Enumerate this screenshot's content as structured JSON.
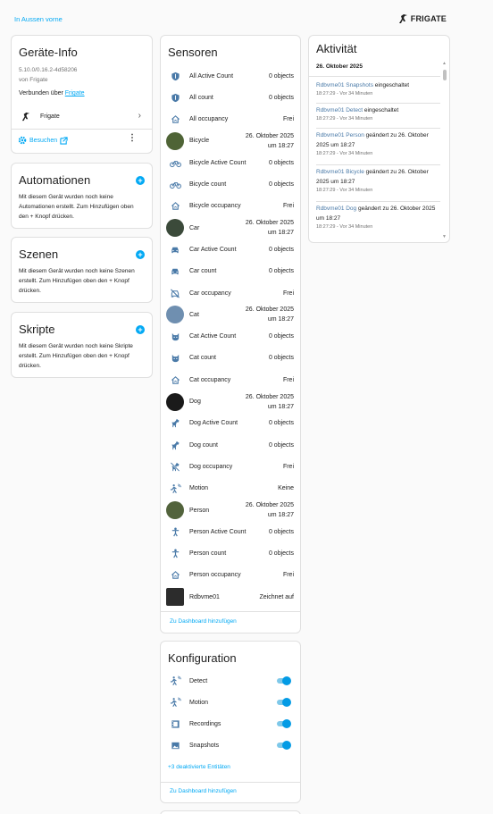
{
  "header": {
    "area": "In Aussen vorne",
    "brand": "FRIGATE"
  },
  "device_info": {
    "title": "Geräte-Info",
    "version": "5.10.0/0.16.2-4d58206",
    "vendor": "von Frigate",
    "connected_prefix": "Verbunden über ",
    "connected_link": "Frigate",
    "integration": "Frigate",
    "search_label": "Besuchen"
  },
  "automations": {
    "title": "Automationen",
    "text": "Mit diesem Gerät wurden noch keine Automationen erstellt. Zum Hinzufügen oben den + Knopf drücken."
  },
  "scenes": {
    "title": "Szenen",
    "text": "Mit diesem Gerät wurden noch keine Szenen erstellt. Zum Hinzufügen oben den + Knopf drücken."
  },
  "scripts": {
    "title": "Skripte",
    "text": "Mit diesem Gerät wurden noch keine Skripte erstellt. Zum Hinzufügen oben den + Knopf drücken."
  },
  "sensors": {
    "title": "Sensoren",
    "rows": [
      {
        "name": "All Active Count",
        "value": "0 objects",
        "icon": "shield-icon"
      },
      {
        "name": "All count",
        "value": "0 objects",
        "icon": "shield-icon"
      },
      {
        "name": "All occupancy",
        "value": "Frei",
        "icon": "home-icon"
      },
      {
        "name": "Bicycle",
        "value": "26. Oktober 2025 um 18:27",
        "icon": "snapshot-thumbnail"
      },
      {
        "name": "Bicycle Active Count",
        "value": "0 objects",
        "icon": "bicycle-icon"
      },
      {
        "name": "Bicycle count",
        "value": "0 objects",
        "icon": "bicycle-icon"
      },
      {
        "name": "Bicycle occupancy",
        "value": "Frei",
        "icon": "home-icon"
      },
      {
        "name": "Car",
        "value": "26. Oktober 2025 um 18:27",
        "icon": "snapshot-thumbnail"
      },
      {
        "name": "Car Active Count",
        "value": "0 objects",
        "icon": "car-icon"
      },
      {
        "name": "Car count",
        "value": "0 objects",
        "icon": "car-icon"
      },
      {
        "name": "Car occupancy",
        "value": "Frei",
        "icon": "car-off-icon"
      },
      {
        "name": "Cat",
        "value": "26. Oktober 2025 um 18:27",
        "icon": "snapshot-thumbnail"
      },
      {
        "name": "Cat Active Count",
        "value": "0 objects",
        "icon": "cat-icon"
      },
      {
        "name": "Cat count",
        "value": "0 objects",
        "icon": "cat-icon"
      },
      {
        "name": "Cat occupancy",
        "value": "Frei",
        "icon": "home-icon"
      },
      {
        "name": "Dog",
        "value": "26. Oktober 2025 um 18:27",
        "icon": "snapshot-thumbnail"
      },
      {
        "name": "Dog Active Count",
        "value": "0 objects",
        "icon": "dog-icon"
      },
      {
        "name": "Dog count",
        "value": "0 objects",
        "icon": "dog-icon"
      },
      {
        "name": "Dog occupancy",
        "value": "Frei",
        "icon": "dog-off-icon"
      },
      {
        "name": "Motion",
        "value": "Keine",
        "icon": "motion-sensor-icon"
      },
      {
        "name": "Person",
        "value": "26. Oktober 2025 um 18:27",
        "icon": "snapshot-thumbnail"
      },
      {
        "name": "Person Active Count",
        "value": "0 objects",
        "icon": "person-icon"
      },
      {
        "name": "Person count",
        "value": "0 objects",
        "icon": "person-icon"
      },
      {
        "name": "Person occupancy",
        "value": "Frei",
        "icon": "home-icon"
      },
      {
        "name": "Rdbvme01",
        "value": "Zeichnet auf",
        "icon": "camera-thumbnail"
      }
    ],
    "add_to_dashboard": "Zu Dashboard hinzufügen"
  },
  "config": {
    "title": "Konfiguration",
    "rows": [
      {
        "name": "Detect",
        "icon": "motion-sensor-icon",
        "on": true
      },
      {
        "name": "Motion",
        "icon": "motion-sensor-icon",
        "on": true
      },
      {
        "name": "Recordings",
        "icon": "film-icon",
        "on": true
      },
      {
        "name": "Snapshots",
        "icon": "image-icon",
        "on": true
      }
    ],
    "disabled_entities": "+3 deaktivierte Entitäten",
    "add_to_dashboard": "Zu Dashboard hinzufügen"
  },
  "activity": {
    "title": "Aktivität",
    "date": "26. Oktober 2025",
    "entries": [
      {
        "entity": "Rdbvme01 Snapshots",
        "text": " eingeschaltet",
        "time": "18:27:29 - Vor 34 Minuten"
      },
      {
        "entity": "Rdbvme01 Detect",
        "text": " eingeschaltet",
        "time": "18:27:29 - Vor 34 Minuten"
      },
      {
        "entity": "Rdbvme01 Person",
        "text": " geändert zu 26. Oktober 2025 um 18:27",
        "time": "18:27:29 - Vor 34 Minuten"
      },
      {
        "entity": "Rdbvme01 Bicycle",
        "text": " geändert zu 26. Oktober 2025 um 18:27",
        "time": "18:27:29 - Vor 34 Minuten"
      },
      {
        "entity": "Rdbvme01 Dog",
        "text": " geändert zu 26. Oktober 2025 um 18:27",
        "time": "18:27:29 - Vor 34 Minuten"
      }
    ]
  },
  "colors": {
    "accent": "#03a9f4",
    "icon": "#4a7aa8",
    "toggle": "#039be5"
  }
}
